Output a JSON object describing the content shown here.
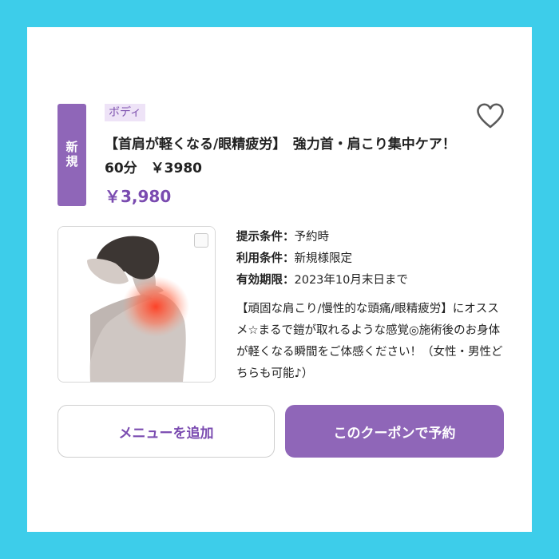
{
  "coupon": {
    "new_badge": "新規",
    "category": "ボディ",
    "title": "【首肩が軽くなる/眼精疲労】　強力首・肩こり集中ケア！　60分　￥3980",
    "price": "￥3,980",
    "favorite_icon": "heart-outline-icon",
    "image_alt": "neck-shoulder-pain-illustration",
    "conditions": [
      {
        "label": "提示条件：",
        "value": "予約時"
      },
      {
        "label": "利用条件：",
        "value": "新規様限定"
      },
      {
        "label": "有効期限：",
        "value": "2023年10月末日まで"
      }
    ],
    "description": "【頑固な肩こり/慢性的な頭痛/眼精疲労】にオススメ☆まるで鎧が取れるような感覚◎施術後のお身体が軽くなる瞬間をご体感ください！（女性・男性どちらも可能♪）",
    "add_menu_label": "メニューを追加",
    "reserve_label": "このクーポンで予約"
  },
  "colors": {
    "border": "#3dcdea",
    "accent": "#8f66b8",
    "accent_text": "#7a4bb0",
    "category_bg": "#eee3f7"
  }
}
